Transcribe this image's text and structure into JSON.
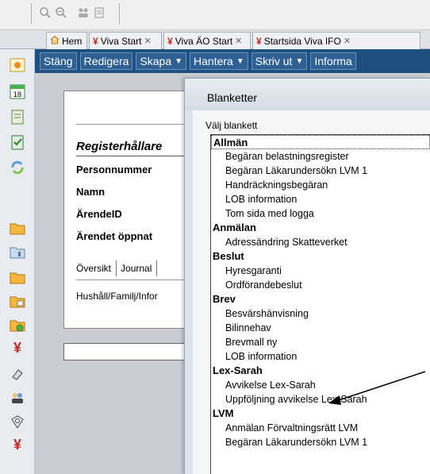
{
  "tabs": [
    {
      "label": "Hem",
      "icon": "home-icon"
    },
    {
      "label": "Viva Start",
      "icon": "viva-icon"
    },
    {
      "label": "Viva ÄO Start",
      "icon": "viva-icon"
    },
    {
      "label": "Startsida Viva IFO",
      "icon": "viva-icon"
    }
  ],
  "actions": [
    {
      "label": "Stäng",
      "dropdown": false
    },
    {
      "label": "Redigera",
      "dropdown": false
    },
    {
      "label": "Skapa",
      "dropdown": true
    },
    {
      "label": "Hantera",
      "dropdown": true
    },
    {
      "label": "Skriv ut",
      "dropdown": true
    },
    {
      "label": "Informa",
      "dropdown": false
    }
  ],
  "record": {
    "title": "Registerhållare",
    "fields": [
      "Personnummer",
      "Namn",
      "ÄrendeID",
      "Ärendet öppnat"
    ],
    "subtabs": [
      "Översikt",
      "Journal"
    ],
    "household": "Hushåll/Familj/Infor"
  },
  "dialog": {
    "title": "Blanketter",
    "prompt": "Välj blankett",
    "list": [
      {
        "text": "Allmän",
        "type": "group"
      },
      {
        "text": "Begäran belastningsregister",
        "type": "item"
      },
      {
        "text": "Begäran Läkarundersökn LVM 1",
        "type": "item"
      },
      {
        "text": "Handräckningsbegäran",
        "type": "item"
      },
      {
        "text": "LOB information",
        "type": "item"
      },
      {
        "text": "Tom sida med logga",
        "type": "item"
      },
      {
        "text": "Anmälan",
        "type": "group"
      },
      {
        "text": "Adressändring Skatteverket",
        "type": "item"
      },
      {
        "text": "Beslut",
        "type": "group"
      },
      {
        "text": "Hyresgaranti",
        "type": "item"
      },
      {
        "text": "Ordförandebeslut",
        "type": "item"
      },
      {
        "text": "Brev",
        "type": "group"
      },
      {
        "text": "Besvärshänvisning",
        "type": "item"
      },
      {
        "text": "Bilinnehav",
        "type": "item"
      },
      {
        "text": "Brevmall ny",
        "type": "item"
      },
      {
        "text": "LOB information",
        "type": "item"
      },
      {
        "text": "Lex-Sarah",
        "type": "group"
      },
      {
        "text": "Avvikelse Lex-Sarah",
        "type": "item"
      },
      {
        "text": "Uppföljning avvikelse Lex-Sarah",
        "type": "item"
      },
      {
        "text": "LVM",
        "type": "group"
      },
      {
        "text": "Anmälan Förvaltningsrätt LVM",
        "type": "item"
      },
      {
        "text": "Begäran Läkarundersökn LVM 1",
        "type": "item"
      }
    ]
  },
  "sidebar_icons": [
    "calendar-icon",
    "calendar-18-icon",
    "document-icon",
    "checklist-icon",
    "refresh-icon",
    "folder-icon",
    "folder-chart-icon",
    "folder-icon",
    "folder-table-icon",
    "folder-globe-icon",
    "viva-icon",
    "eraser-icon",
    "users-icon",
    "magnifier-icon",
    "viva-icon"
  ],
  "colors": {
    "actionbar": "#1f4f7f",
    "accent": "#c62828"
  }
}
